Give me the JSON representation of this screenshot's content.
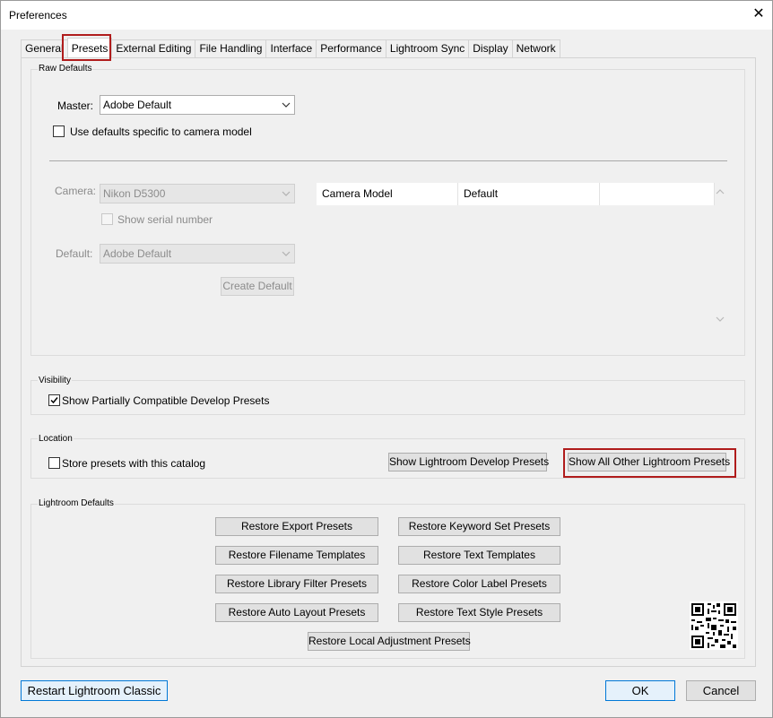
{
  "window": {
    "title": "Preferences"
  },
  "tabs": [
    {
      "label": "General"
    },
    {
      "label": "Presets",
      "active": true
    },
    {
      "label": "External Editing"
    },
    {
      "label": "File Handling"
    },
    {
      "label": "Interface"
    },
    {
      "label": "Performance"
    },
    {
      "label": "Lightroom Sync"
    },
    {
      "label": "Display"
    },
    {
      "label": "Network"
    }
  ],
  "raw_defaults": {
    "group_label": "Raw Defaults",
    "master_label": "Master:",
    "master_value": "Adobe Default",
    "use_camera_defaults_label": "Use defaults specific to camera model",
    "use_camera_defaults_checked": false,
    "camera_label": "Camera:",
    "camera_value": "Nikon D5300",
    "show_serial_label": "Show serial number",
    "default_label": "Default:",
    "default_value": "Adobe Default",
    "create_default_label": "Create Default",
    "table_headers": [
      "Camera Model",
      "Default",
      ""
    ]
  },
  "visibility": {
    "group_label": "Visibility",
    "show_partial_label": "Show Partially Compatible Develop Presets",
    "show_partial_checked": true
  },
  "location": {
    "group_label": "Location",
    "store_presets_label": "Store presets with this catalog",
    "store_presets_checked": false,
    "show_develop_label": "Show Lightroom Develop Presets",
    "show_other_label": "Show All Other Lightroom Presets"
  },
  "lightroom_defaults": {
    "group_label": "Lightroom Defaults",
    "buttons": [
      "Restore Export Presets",
      "Restore Keyword Set Presets",
      "Restore Filename Templates",
      "Restore Text Templates",
      "Restore Library Filter Presets",
      "Restore Color Label Presets",
      "Restore Auto Layout Presets",
      "Restore Text Style Presets",
      "Restore Local Adjustment Presets"
    ]
  },
  "footer": {
    "restart_label": "Restart Lightroom Classic",
    "ok_label": "OK",
    "cancel_label": "Cancel"
  },
  "colors": {
    "highlight_red": "#b01c1c",
    "primary_blue": "#0078d7"
  }
}
